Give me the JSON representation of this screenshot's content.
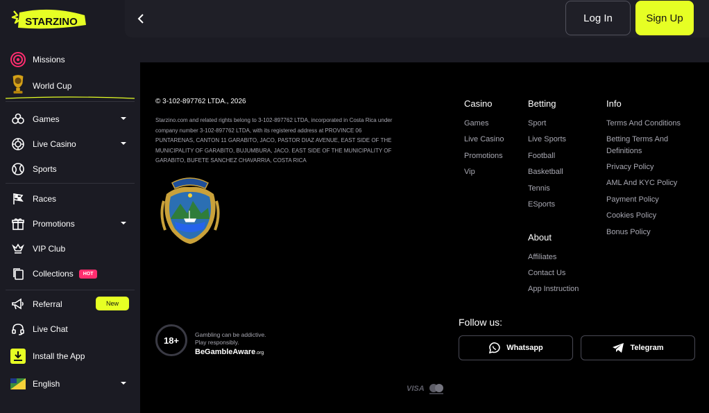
{
  "brand": {
    "logo_text": "STARZINO"
  },
  "sidebar": {
    "items": [
      {
        "label": "Missions",
        "icon": "target-icon"
      },
      {
        "label": "World Cup",
        "icon": "trophy-icon"
      },
      {
        "label": "Games",
        "icon": "games-icon"
      },
      {
        "label": "Live Casino",
        "icon": "chip-icon"
      },
      {
        "label": "Sports",
        "icon": "ball-icon"
      },
      {
        "label": "Races",
        "icon": "flag-icon"
      },
      {
        "label": "Promotions",
        "icon": "gift-icon"
      },
      {
        "label": "VIP Club",
        "icon": "crown-icon"
      },
      {
        "label": "Collections",
        "icon": "cards-icon",
        "badge": "HOT"
      },
      {
        "label": "Referral",
        "icon": "megaphone-icon",
        "badge": "New"
      },
      {
        "label": "Live Chat",
        "icon": "headset-icon"
      },
      {
        "label": "Install the App",
        "icon": "download-icon"
      },
      {
        "label": "English",
        "icon": "flag-uk-icon"
      }
    ]
  },
  "header": {
    "login_label": "Log In",
    "signup_label": "Sign Up"
  },
  "footer": {
    "copyright": "© 3-102-897762 LTDA., 2026",
    "legal": "Starzino.com and related rights belong to 3-102-897762 LTDA, incorporated in Costa Rica under company number 3-102-897762 LTDA, with its registered address at PROVINCE 06 PUNTARENAS, CANTON 11 GARABITO, JACO, PASTOR DIAZ AVENUE, EAST SIDE OF THE MUNICIPALITY OF GARABITO, BUJUMBURA, JACO. EAST SIDE OF THE MUNICIPALITY OF GARABITO, BUFETE SANCHEZ CHAVARRIA, COSTA RICA",
    "casino": {
      "title": "Casino",
      "links": [
        "Games",
        "Live Casino",
        "Promotions",
        "Vip"
      ]
    },
    "betting": {
      "title": "Betting",
      "links": [
        "Sport",
        "Live Sports",
        "Football",
        "Basketball",
        "Tennis",
        "ESports"
      ]
    },
    "about": {
      "title": "About",
      "links": [
        "Affiliates",
        "Contact Us",
        "App Instruction"
      ]
    },
    "info": {
      "title": "Info",
      "links": [
        "Terms And Conditions",
        "Betting Terms And",
        "Definitions",
        "Privacy Policy",
        "AML And KYC Policy",
        "Payment Policy",
        "Cookies Policy",
        "Bonus Policy"
      ]
    },
    "age": "18+",
    "gambling_line1": "Gambling can be addictive.",
    "gambling_line2": "Play responsibly.",
    "begamble": "BeGambleAware",
    "begamble_org": ".org",
    "follow": "Follow us:",
    "whatsapp": "Whatsapp",
    "telegram": "Telegram",
    "visa": "VISA"
  },
  "colors": {
    "accent": "#e6ff24",
    "sidebar": "#1b1b23",
    "hot": "#ff2d6f"
  }
}
